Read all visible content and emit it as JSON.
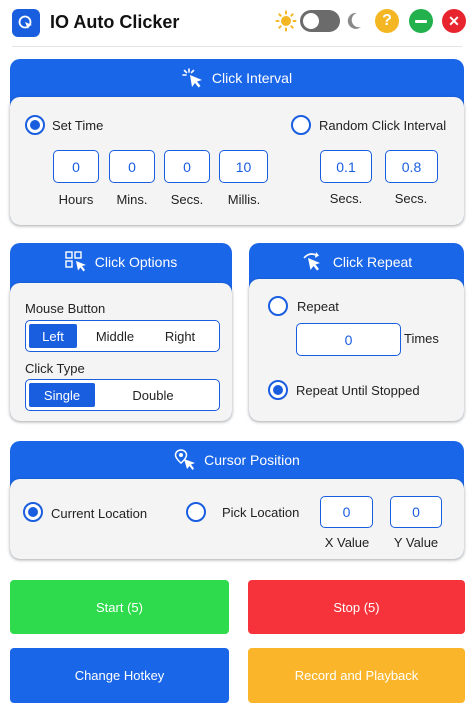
{
  "app": {
    "title": "IO Auto Clicker"
  },
  "titlebar": {
    "help_glyph": "?",
    "close_glyph": "✕"
  },
  "click_interval": {
    "title": "Click Interval",
    "set_time_label": "Set Time",
    "random_label": "Random Click Interval",
    "selected": "set_time",
    "fields": [
      {
        "value": "0",
        "caption": "Hours"
      },
      {
        "value": "0",
        "caption": "Mins."
      },
      {
        "value": "0",
        "caption": "Secs."
      },
      {
        "value": "10",
        "caption": "Millis."
      }
    ],
    "random_fields": [
      {
        "value": "0.1",
        "caption": "Secs."
      },
      {
        "value": "0.8",
        "caption": "Secs."
      }
    ]
  },
  "click_options": {
    "title": "Click Options",
    "mouse_button_label": "Mouse Button",
    "mouse_buttons": [
      "Left",
      "Middle",
      "Right"
    ],
    "mouse_selected": "Left",
    "click_type_label": "Click Type",
    "click_types": [
      "Single",
      "Double"
    ],
    "click_type_selected": "Single"
  },
  "click_repeat": {
    "title": "Click Repeat",
    "repeat_label": "Repeat",
    "repeat_value": "0",
    "times_label": "Times",
    "until_stopped_label": "Repeat Until Stopped",
    "selected": "until_stopped"
  },
  "cursor_position": {
    "title": "Cursor Position",
    "current_label": "Current Location",
    "pick_label": "Pick Location",
    "selected": "current",
    "x_value": "0",
    "y_value": "0",
    "x_caption": "X Value",
    "y_caption": "Y Value"
  },
  "actions": {
    "start_label": "Start (5)",
    "stop_label": "Stop (5)",
    "hotkey_label": "Change Hotkey",
    "record_label": "Record and Playback"
  },
  "colors": {
    "primary": "#1a66e8",
    "start": "#2edb4c",
    "stop": "#f6333b",
    "record": "#fbb52b"
  },
  "icons": [
    "app-cursor-icon",
    "sun-icon",
    "moon-icon",
    "help-icon",
    "minimize-icon",
    "close-icon",
    "click-pointer-icon",
    "grid-options-icon",
    "repeat-pointer-icon",
    "location-pointer-icon"
  ]
}
